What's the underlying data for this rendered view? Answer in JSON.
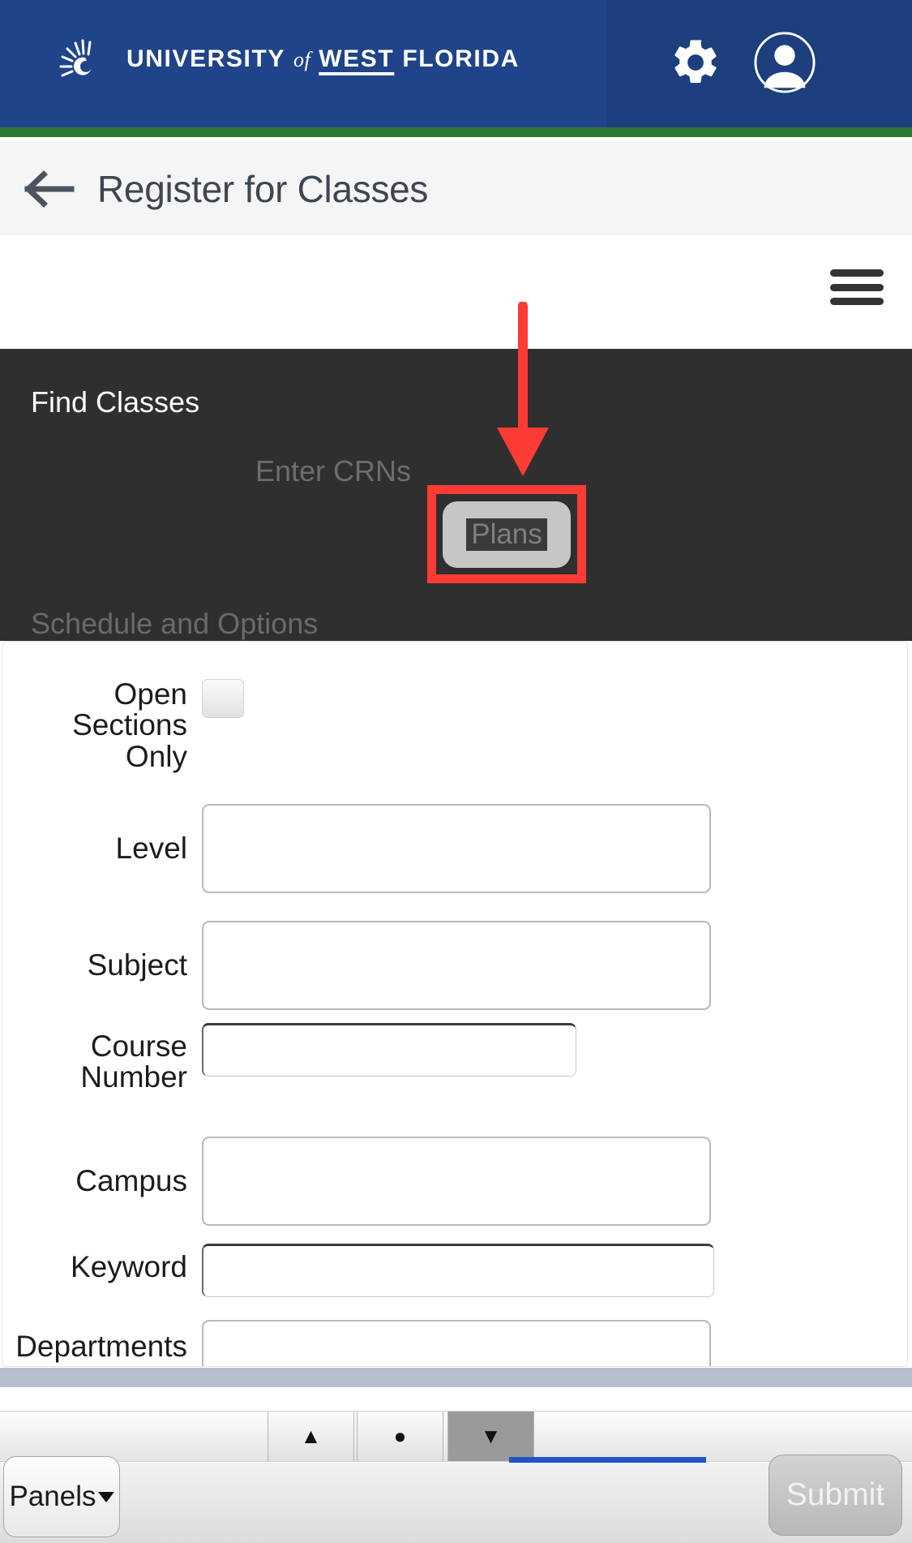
{
  "header": {
    "brand_university": "UNIVERSITY",
    "brand_of": "of",
    "brand_west": "WEST",
    "brand_florida": "FLORIDA",
    "gear_icon": "gear-icon",
    "avatar_icon": "user-avatar-icon",
    "brand_color": "#1f4489",
    "accent_green": "#2d7a34"
  },
  "titlebar": {
    "back_icon": "back-arrow-icon",
    "title": "Register for Classes"
  },
  "menu": {
    "hamburger_icon": "hamburger-menu-icon"
  },
  "panel": {
    "heading": "Find Classes",
    "tabs": [
      {
        "label": "Enter CRNs"
      },
      {
        "label": "Plans"
      },
      {
        "label": "Schedule and Options"
      }
    ],
    "highlight_color": "#ff3b35",
    "panel_bg": "#2f2f2f"
  },
  "annotation": {
    "arrow_icon": "red-down-arrow-annotation",
    "highlight_target": "Plans",
    "color": "#ff3b35"
  },
  "form": {
    "fields": [
      {
        "label": "Open Sections Only",
        "type": "checkbox",
        "value": ""
      },
      {
        "label": "Level",
        "type": "select",
        "value": ""
      },
      {
        "label": "Subject",
        "type": "select",
        "value": ""
      },
      {
        "label": "Course Number",
        "type": "text",
        "value": ""
      },
      {
        "label": "Campus",
        "type": "select",
        "value": ""
      },
      {
        "label": "Keyword",
        "type": "text",
        "value": ""
      },
      {
        "label": "Departments",
        "type": "select",
        "value": ""
      }
    ]
  },
  "bottom": {
    "scroll_up_icon": "triangle-up-icon",
    "scroll_dot_icon": "dot-icon",
    "scroll_down_icon": "triangle-down-icon",
    "panels_label": "Panels",
    "submit_label": "Submit",
    "progress_color": "#2255c4"
  }
}
